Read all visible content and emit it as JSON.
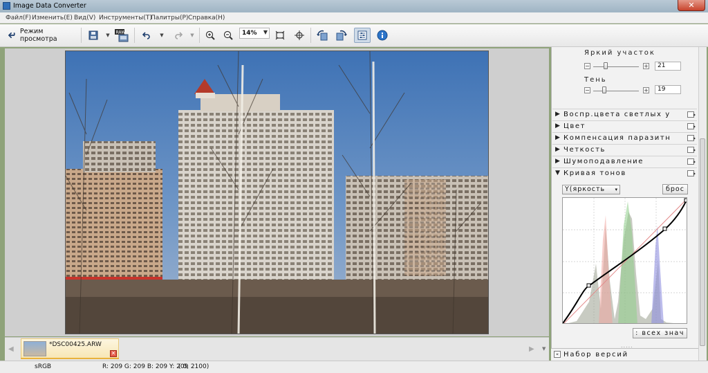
{
  "window": {
    "title": "Image Data Converter",
    "close_glyph": "✕"
  },
  "menu": [
    "Файл(F)",
    "Изменить(E)",
    "Вид(V)",
    "Инструменты(T)",
    "Палитры(P)",
    "Справка(H)"
  ],
  "toolbar": {
    "view_mode_label": "Режим просмотра",
    "zoom_value": "14%",
    "icons": [
      "back-arrow-icon",
      "save-icon",
      "raw-export-icon",
      "undo-icon",
      "redo-icon",
      "zoom-in-icon",
      "zoom-out-icon",
      "fit-window-icon",
      "crosshair-icon",
      "rotate-left-icon",
      "rotate-right-icon",
      "adjust-panel-icon",
      "info-icon"
    ]
  },
  "panel": {
    "highlight": {
      "label": "Яркий участок",
      "value": "21",
      "minus": "−",
      "plus": "+"
    },
    "shadow": {
      "label": "Тень",
      "value": "19",
      "minus": "−",
      "plus": "+"
    },
    "sections": [
      {
        "arrow": "▶",
        "label": "Воспр.цвета светлых у"
      },
      {
        "arrow": "▶",
        "label": "Цвет"
      },
      {
        "arrow": "▶",
        "label": "Компенсация паразитн"
      },
      {
        "arrow": "▶",
        "label": "Четкость"
      },
      {
        "arrow": "▶",
        "label": "Шумоподавление"
      },
      {
        "arrow": "▼",
        "label": "Кривая тонов"
      }
    ],
    "tone_curve": {
      "channel": "Y(яркость",
      "channel_arrow": "▾",
      "reset_label": "брос",
      "all_values_label": ": всех знач",
      "resize_dots": "....."
    },
    "versions": {
      "icon": "«",
      "label": "Набор версий"
    }
  },
  "thumbnails": {
    "left_arrow": "◀",
    "right_arrow": "▶",
    "menu_glyph": "▼",
    "items": [
      {
        "name": "*DSC00425.ARW",
        "remove": "✕"
      }
    ]
  },
  "status": {
    "colorspace": "sRGB",
    "rgb": "R: 209  G: 209  B: 209  Y: 209",
    "coords": "(   0, 2100)"
  },
  "colors": {
    "accent": "#e9b23c",
    "window_frame": "#9fb4c4",
    "sky_top": "#4a7ab8",
    "curve": "#000000"
  }
}
